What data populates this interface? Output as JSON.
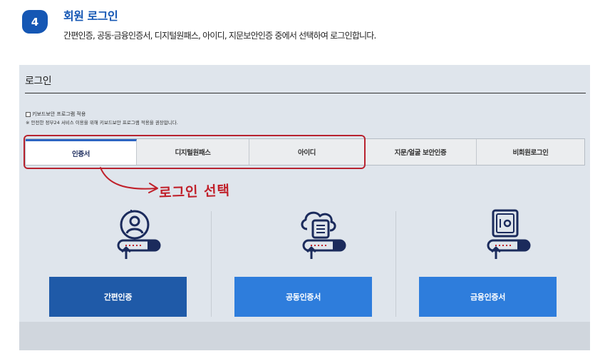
{
  "step": {
    "number": "4",
    "title": "회원 로그인",
    "description": "간편인증, 공동·금융인증서, 디지털원패스, 아이디, 지문보안인증 중에서 선택하여 로그인합니다."
  },
  "login": {
    "title": "로그인",
    "keyboard_security_label": "키보드보안 프로그램 적용",
    "keyboard_security_note": "※ 안전한 정부24 서비스 이용을 위해 키보드보안 프로그램 적용을 권장합니다."
  },
  "tabs": [
    {
      "label": "인증서",
      "active": true
    },
    {
      "label": "디지털원패스",
      "active": false
    },
    {
      "label": "아이디",
      "active": false
    },
    {
      "label": "지문/얼굴 보안인증",
      "active": false
    },
    {
      "label": "비회원로그인",
      "active": false
    }
  ],
  "annotation": {
    "text": "로그인 선택",
    "color": "#c0202a"
  },
  "methods": [
    {
      "icon": "person-login-icon",
      "button_label": "간편인증",
      "button_color": "#1f5aa8"
    },
    {
      "icon": "cloud-certificate-login-icon",
      "button_label": "공동인증서",
      "button_color": "#2e7ddc"
    },
    {
      "icon": "safe-login-icon",
      "button_label": "금융인증서",
      "button_color": "#2e7ddc"
    }
  ],
  "colors": {
    "brand_blue": "#1557b4",
    "panel_bg": "#dfe5ec"
  }
}
